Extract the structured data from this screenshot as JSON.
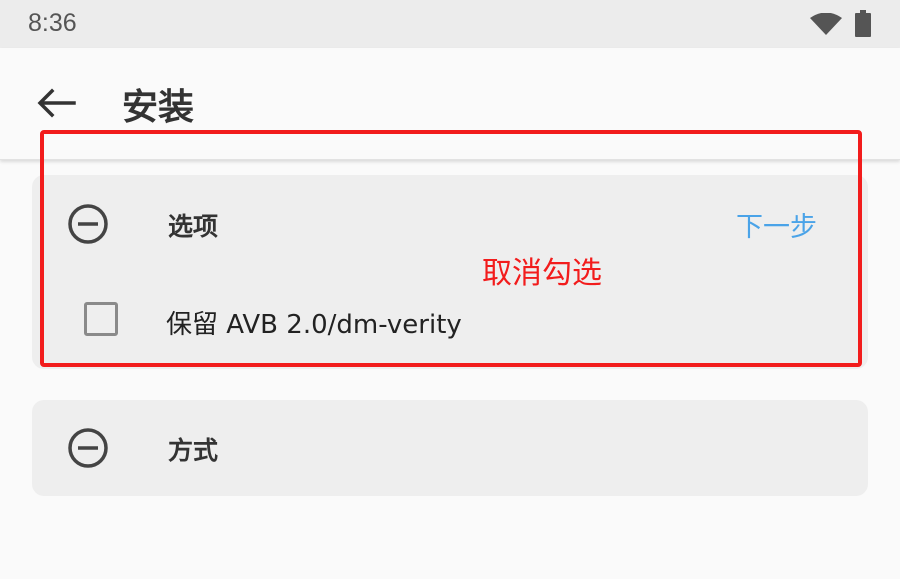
{
  "status_bar": {
    "time": "8:36",
    "icons": [
      "wifi-icon",
      "battery-icon"
    ]
  },
  "app_bar": {
    "back_icon": "arrow-left-icon",
    "title": "安装"
  },
  "options_card": {
    "title": "选项",
    "next_label": "下一步",
    "checkbox": {
      "label": "保留 AVB 2.0/dm-verity",
      "checked": false
    }
  },
  "method_card": {
    "title": "方式"
  },
  "annotation": {
    "text": "取消勾选",
    "color": "#f21c1c"
  },
  "colors": {
    "accent": "#4aa3e8",
    "annotation": "#f21c1c",
    "card_background": "#eeeeee",
    "page_background": "#fafafa"
  }
}
